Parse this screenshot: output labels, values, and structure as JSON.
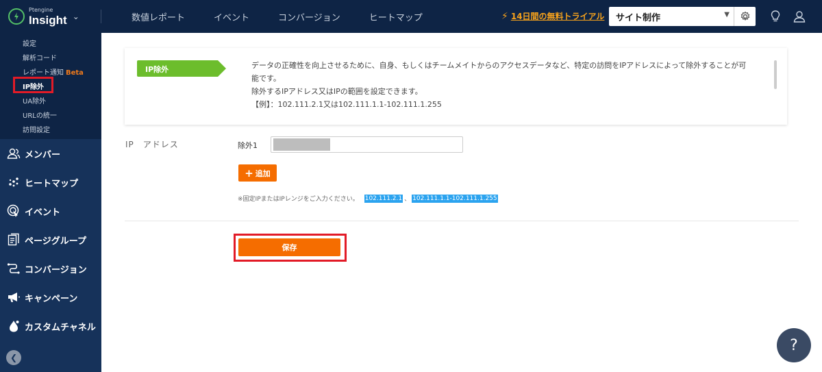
{
  "header": {
    "logo_sub": "Ptengine",
    "logo_main": "Insight",
    "nav": [
      "数値レポート",
      "イベント",
      "コンバージョン",
      "ヒートマップ"
    ],
    "trial_text": "14日間の無料トライアル",
    "site_selected": "サイト制作"
  },
  "sidebar": {
    "submenu": [
      {
        "label": "設定"
      },
      {
        "label": "解析コード"
      },
      {
        "label": "レポート通知",
        "badge": "Beta"
      },
      {
        "label": "IP除外"
      },
      {
        "label": "UA除外"
      },
      {
        "label": "URLの統一"
      },
      {
        "label": "訪問設定"
      }
    ],
    "menu": [
      {
        "label": "メンバー",
        "icon": "members-icon"
      },
      {
        "label": "ヒートマップ",
        "icon": "heatmap-icon"
      },
      {
        "label": "イベント",
        "icon": "event-icon"
      },
      {
        "label": "ページグループ",
        "icon": "page-group-icon"
      },
      {
        "label": "コンバージョン",
        "icon": "conversion-icon"
      },
      {
        "label": "キャンペーン",
        "icon": "campaign-icon"
      },
      {
        "label": "カスタムチャネル",
        "icon": "custom-channel-icon"
      }
    ]
  },
  "info": {
    "tag": "IP除外",
    "line1": "データの正確性を向上させるために、自身、もしくはチームメイトからのアクセスデータなど、特定の訪問をIPアドレスによって除外することが可",
    "line2": "能です。",
    "line3": "除外するIPアドレス又はIPの範囲を設定できます。",
    "line4": "【例】：102.111.2.1又は102.111.1.1-102.111.1.255"
  },
  "form": {
    "ip_label": "IP　アドレス",
    "exclusion_label": "除外1",
    "add_label": "追加",
    "hint_prefix": "※固定IPまたはIPレンジをご入力ください。",
    "hint_ex1": "102.111.2.1",
    "hint_sep": "、",
    "hint_ex2": "102.111.1.1-102.111.1.255",
    "save_label": "保存"
  },
  "help": "?",
  "colors": {
    "header_bg": "#0e2445",
    "accent_orange": "#f56d00",
    "tag_green": "#6cbd2c",
    "highlight_red": "#e21b27"
  }
}
